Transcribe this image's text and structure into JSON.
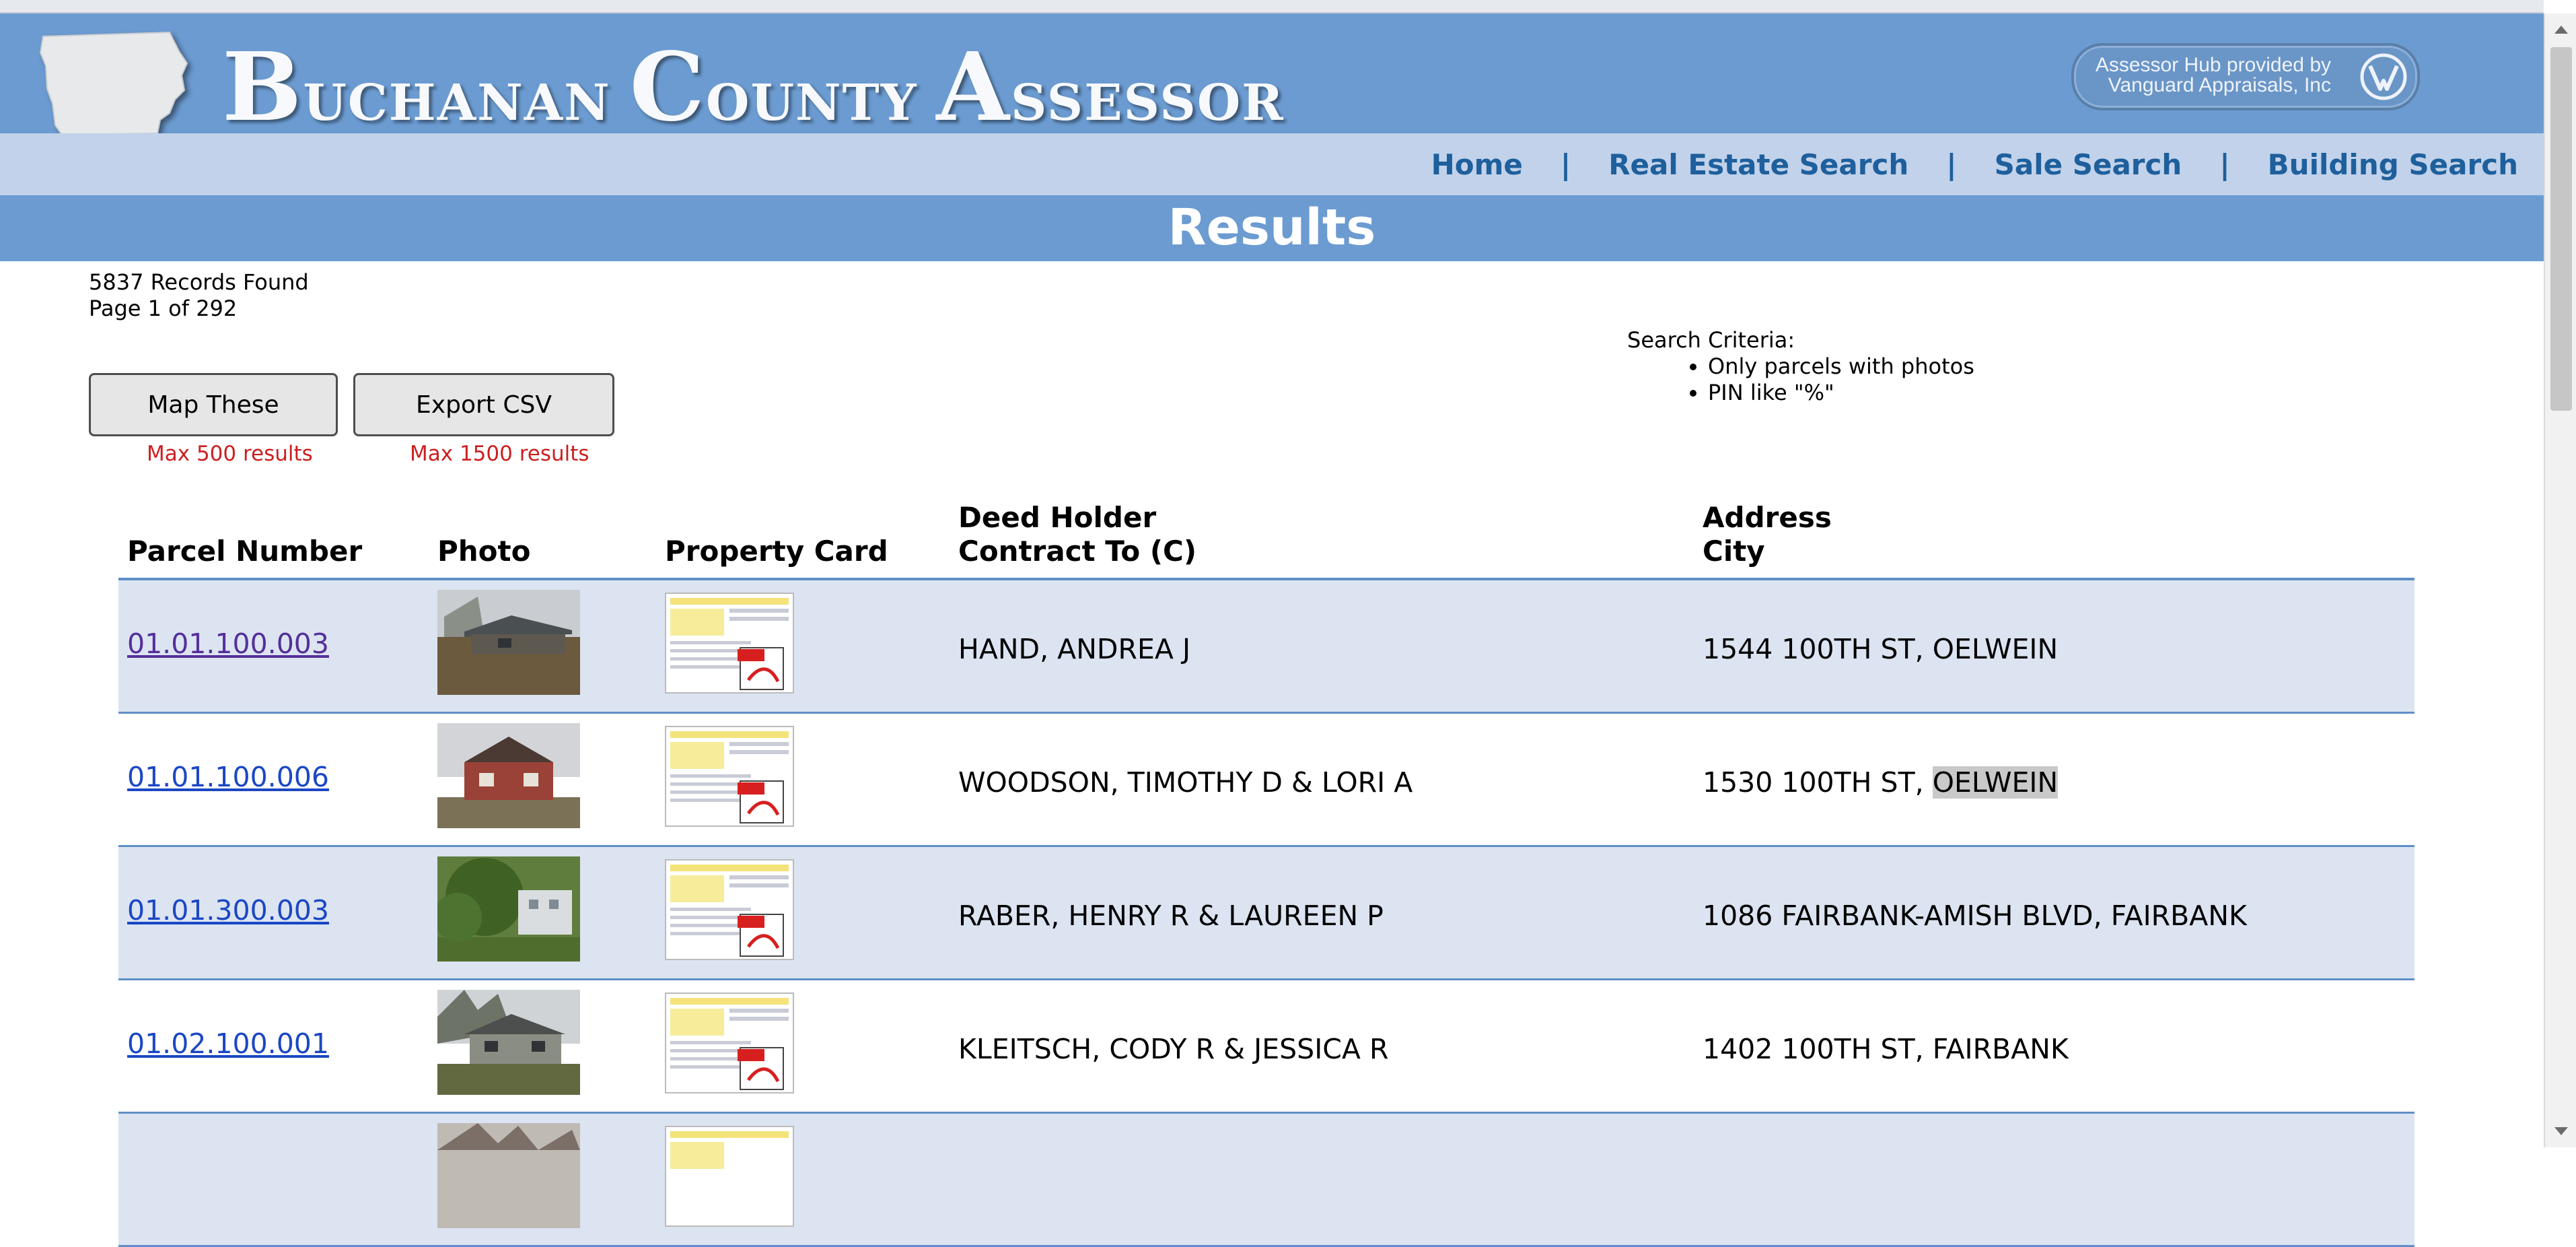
{
  "header": {
    "title_initial_1": "B",
    "title_rest_1": "uchanan ",
    "title_initial_2": "C",
    "title_rest_2": "ounty ",
    "title_initial_3": "A",
    "title_rest_3": "ssessor",
    "badge_line1": "Assessor Hub provided by",
    "badge_line2": "Vanguard Appraisals, Inc",
    "logo_icon": "iowa-state-outline-icon",
    "vendor_icon": "vanguard-logo-icon"
  },
  "nav": {
    "items": [
      "Home",
      "Real Estate Search",
      "Sale Search",
      "Building Search"
    ],
    "separator": "|"
  },
  "results_title": "Results",
  "info": {
    "records": "5837 Records Found",
    "page": "Page 1 of 292"
  },
  "actions": {
    "map_label": "Map These",
    "map_note": "Max 500 results",
    "csv_label": "Export CSV",
    "csv_note": "Max 1500 results"
  },
  "criteria": {
    "heading": "Search Criteria:",
    "items": [
      "Only parcels with photos",
      "PIN like \"%\""
    ]
  },
  "table": {
    "headers": {
      "parcel": "Parcel Number",
      "photo": "Photo",
      "card": "Property Card",
      "deed_line1": "Deed Holder",
      "deed_line2": "Contract To (C)",
      "addr_line1": "Address",
      "addr_line2": "City"
    },
    "rows": [
      {
        "parcel": "01.01.100.003",
        "deed": "HAND, ANDREA J",
        "street": "1544 100TH ST, ",
        "city": "OELWEIN"
      },
      {
        "parcel": "01.01.100.006",
        "deed": "WOODSON, TIMOTHY D & LORI A",
        "street": "1530 100TH ST, ",
        "city": "OELWEIN"
      },
      {
        "parcel": "01.01.300.003",
        "deed": "RABER, HENRY R & LAUREEN P",
        "street": "1086 FAIRBANK-AMISH BLVD, ",
        "city": "FAIRBANK"
      },
      {
        "parcel": "01.02.100.001",
        "deed": "KLEITSCH, CODY R & JESSICA R",
        "street": "1402 100TH ST, ",
        "city": "FAIRBANK"
      },
      {
        "parcel": "",
        "deed": "",
        "street": "",
        "city": ""
      }
    ]
  },
  "colors": {
    "header_blue": "#6b9bd1",
    "nav_bg": "#c1d2ea",
    "nav_text": "#1e5f9c",
    "row_alt": "#dce4f1",
    "note_red": "#cc1f1f"
  }
}
